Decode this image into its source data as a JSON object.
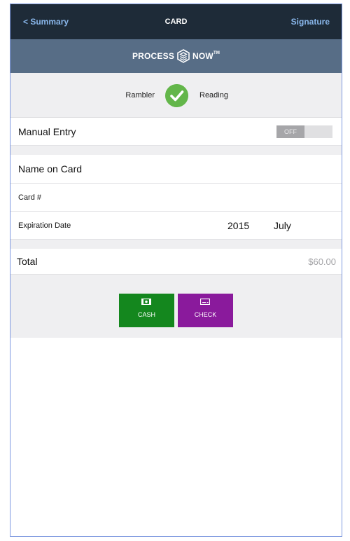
{
  "navbar": {
    "back_label": "< Summary",
    "title": "CARD",
    "next_label": "Signature"
  },
  "brand": {
    "left_word": "PROCESS",
    "right_word": "NOW",
    "trademark": "TM",
    "logo_icon": "hexagon-cube-icon"
  },
  "reader": {
    "device_name": "Rambler",
    "status_icon": "checkmark-circle-icon",
    "status_label": "Reading",
    "status_color": "#63b64a"
  },
  "manual_entry": {
    "label": "Manual Entry",
    "toggle_state": "OFF"
  },
  "form": {
    "name_label": "Name on Card",
    "card_label": "Card #",
    "expiration_label": "Expiration Date",
    "expiration_year": "2015",
    "expiration_month": "July"
  },
  "total": {
    "label": "Total",
    "amount": "$60.00"
  },
  "payment_options": [
    {
      "label": "CASH",
      "icon": "cash-icon",
      "color": "#14871e"
    },
    {
      "label": "CHECK",
      "icon": "check-icon",
      "color": "#8a1a9c"
    }
  ],
  "colors": {
    "navbar_bg": "#1e2b38",
    "brandbar_bg": "#576d86",
    "link_color": "#89b6ea"
  }
}
